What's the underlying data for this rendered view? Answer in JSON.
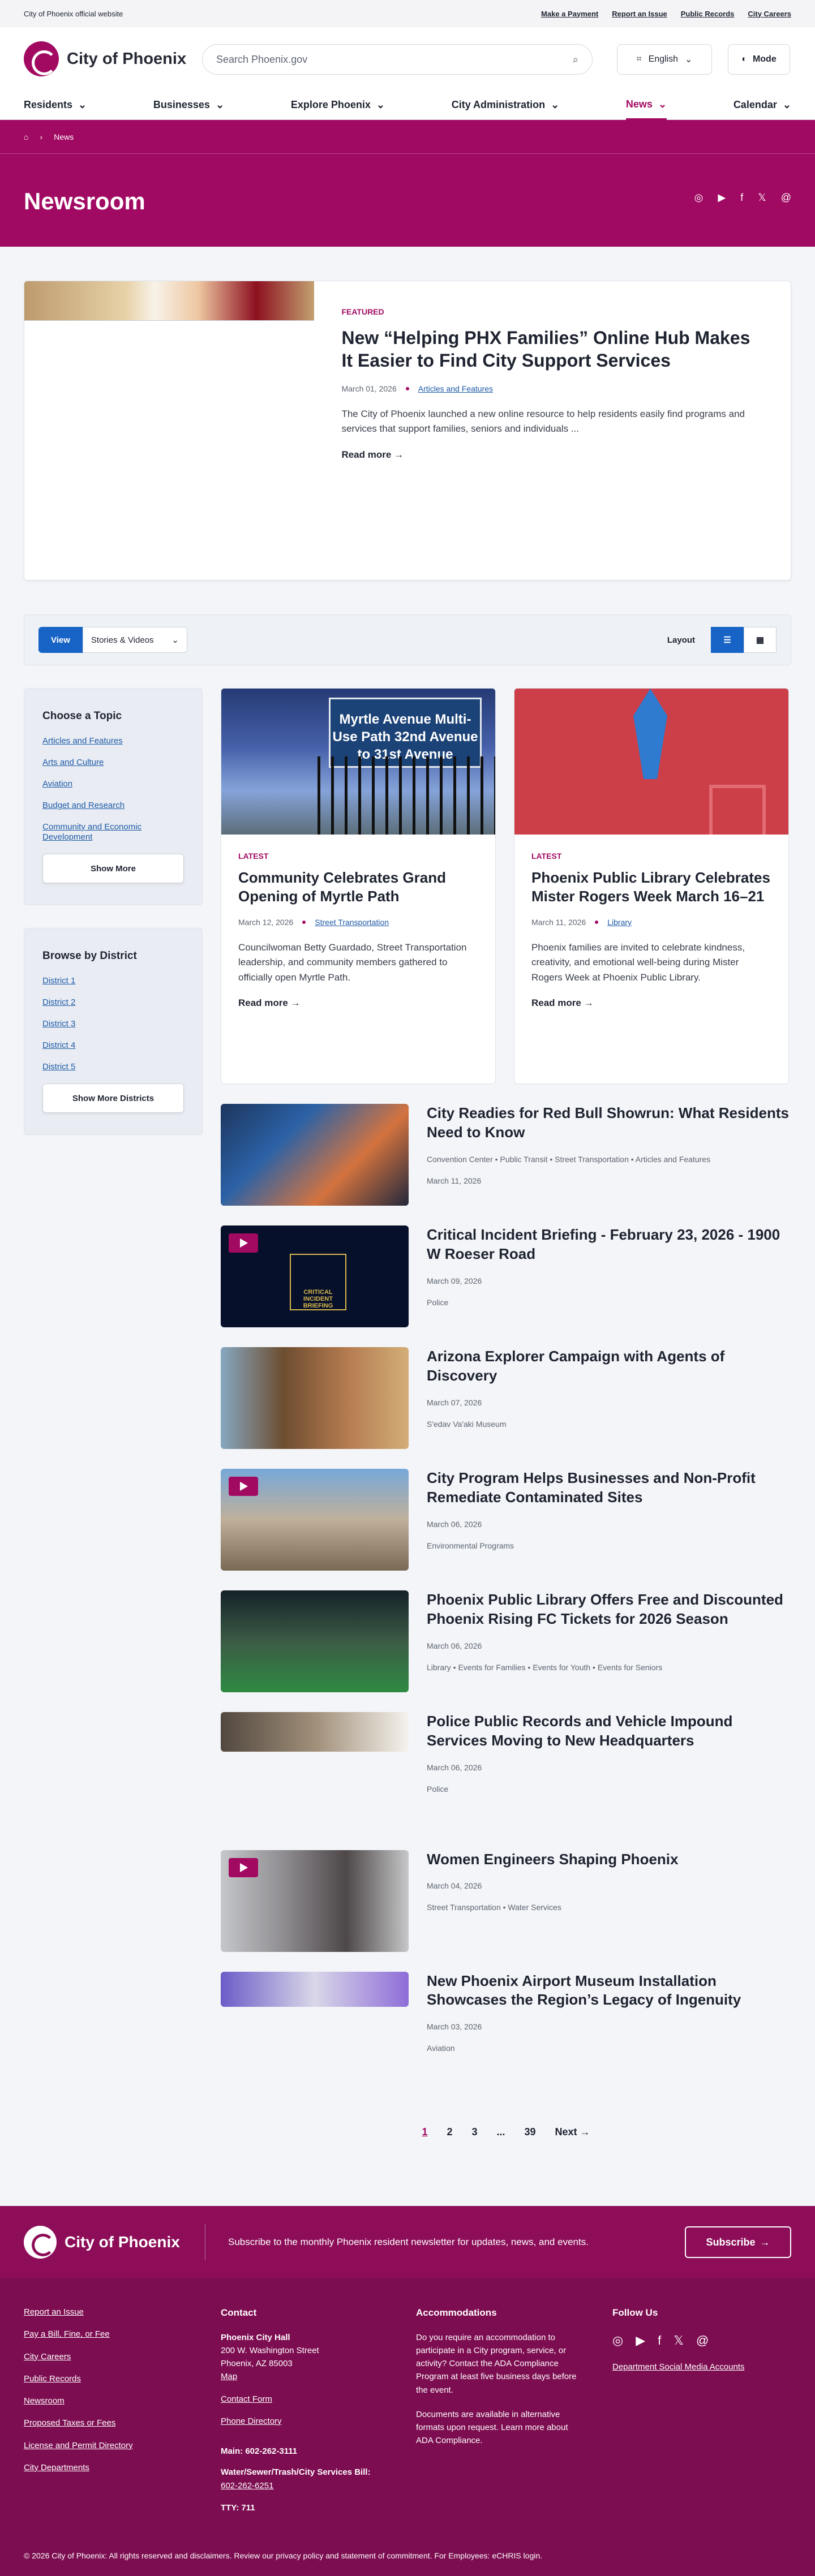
{
  "topbar": {
    "label": "City of Phoenix official website",
    "links": [
      "Make a Payment",
      "Report an Issue",
      "Public Records",
      "City Careers"
    ]
  },
  "header": {
    "logo": "City of Phoenix",
    "search_placeholder": "Search Phoenix.gov",
    "language": "English",
    "mode": "Mode"
  },
  "nav": [
    "Residents",
    "Businesses",
    "Explore Phoenix",
    "City Administration",
    "News",
    "Calendar"
  ],
  "breadcrumb": {
    "current": "News"
  },
  "page": {
    "title": "Newsroom"
  },
  "featured": {
    "kicker": "FEATURED",
    "title": "New “Helping PHX Families” Online Hub Makes It Easier to Find City Support Services",
    "date": "March 01, 2026",
    "tag": "Articles and Features",
    "desc": "The City of Phoenix launched a new online resource to help residents easily find programs and services that support families, seniors and individuals ...",
    "more": "Read more"
  },
  "filters": {
    "view_label": "View",
    "view_value": "Stories & Videos",
    "layout_label": "Layout"
  },
  "topics": {
    "title": "Choose a Topic",
    "items": [
      "Articles and Features",
      "Arts and Culture",
      "Aviation",
      "Budget and Research",
      "Community and Economic Development"
    ],
    "show_more": "Show More"
  },
  "districts": {
    "title": "Browse by District",
    "items": [
      "District 1",
      "District 2",
      "District 3",
      "District 4",
      "District 5"
    ],
    "show_more": "Show More Districts"
  },
  "cards": [
    {
      "kicker": "LATEST",
      "title": "Community Celebrates Grand Opening of Myrtle Path",
      "date": "March 12, 2026",
      "tag": "Street Transportation",
      "desc": "Councilwoman Betty Guardado, Street Transportation leadership, and community members gathered to officially open Myrtle Path.",
      "more": "Read more",
      "sign": "Myrtle Avenue Multi-Use Path 32nd Avenue to 31st Avenue"
    },
    {
      "kicker": "LATEST",
      "title": "Phoenix Public Library Celebrates Mister Rogers Week March 16–21",
      "date": "March 11, 2026",
      "tag": "Library",
      "desc": "Phoenix families are invited to celebrate kindness, creativity, and emotional well-being during Mister Rogers Week at Phoenix Public Library.",
      "more": "Read more"
    }
  ],
  "list": [
    {
      "title": "City Readies for Red Bull Showrun: What Residents Need to Know",
      "date": "March 11, 2026",
      "tags": "Convention Center • Public Transit • Street Transportation • Articles and Features"
    },
    {
      "title": "Critical Incident Briefing - February 23, 2026 - 1900 W Roeser Road",
      "date": "March 09, 2026",
      "tags": "Police"
    },
    {
      "title": "Arizona Explorer Campaign with Agents of Discovery",
      "date": "March 07, 2026",
      "tags": "S'edav Va'aki Museum"
    },
    {
      "title": "City Program Helps Businesses and Non-Profit Remediate Contaminated Sites",
      "date": "March 06, 2026",
      "tags": "Environmental Programs"
    },
    {
      "title": "Phoenix Public Library Offers Free and Discounted Phoenix Rising FC Tickets for 2026 Season",
      "date": "March 06, 2026",
      "tags": "Library • Events for Families • Events for Youth • Events for Seniors"
    },
    {
      "title": "Police Public Records and Vehicle Impound Services Moving to New Headquarters",
      "date": "March 06, 2026",
      "tags": "Police"
    },
    {
      "title": "Women Engineers Shaping Phoenix",
      "date": "March 04, 2026",
      "tags": "Street Transportation • Water Services"
    },
    {
      "title": "New Phoenix Airport Museum Installation Showcases the Region’s Legacy of Ingenuity",
      "date": "March 03, 2026",
      "tags": "Aviation"
    }
  ],
  "badge_text": "CRITICAL INCIDENT BRIEFING",
  "pagination": [
    "1",
    "2",
    "3",
    "...",
    "39",
    "Next"
  ],
  "footer": {
    "logo": "City of Phoenix",
    "newsletter": "Subscribe to the monthly Phoenix resident newsletter for updates, news, and events.",
    "subscribe": "Subscribe",
    "links": [
      "Report an Issue",
      "Pay a Bill, Fine, or Fee",
      "City Careers",
      "Public Records",
      "Newsroom",
      "Proposed Taxes or Fees",
      "License and Permit Directory",
      "City Departments"
    ],
    "contact_title": "Contact",
    "hall": "Phoenix City Hall",
    "address1": "200 W. Washington Street",
    "address2": "Phoenix, AZ 85003",
    "map": "Map",
    "contact_form": "Contact Form",
    "phone_dir": "Phone Directory",
    "main": "Main: 602-262-3111",
    "water_label": "Water/Sewer/Trash/City Services Bill:",
    "water_phone": "602-262-6251",
    "tty": "TTY: 711",
    "access_title": "Accommodations",
    "access_text": "Do you require an accommodation to participate in a City program, service, or activity? Contact the ADA Compliance Program at least five business days before the event.",
    "alt_text": "Documents are available in alternative formats upon request. Learn more about ADA Compliance.",
    "follow_title": "Follow Us",
    "social_accounts": "Department Social Media Accounts",
    "copyright": "© 2026 City of Phoenix: All rights reserved and disclaimers. Review our privacy policy and statement of commitment. For Employees: eCHRIS login."
  }
}
